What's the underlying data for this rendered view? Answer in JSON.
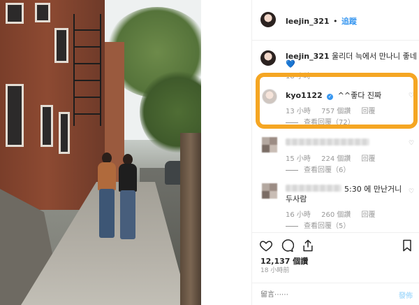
{
  "header": {
    "username": "leejin_321",
    "separator": "•",
    "follow_label": "追蹤"
  },
  "caption": {
    "username": "leejin_321",
    "text": "울리더 늑에서 만나니 좋네"
  },
  "comments": [
    {
      "username": "kyo1122",
      "text": "^^좋다 진짜",
      "time": "13 小時",
      "likes": "757 個讚",
      "reply": "回覆",
      "view_replies": "查看回覆（72）"
    },
    {
      "time": "15 小時",
      "likes": "224 個讚",
      "reply": "回覆",
      "view_replies": "查看回覆（6）"
    },
    {
      "text_line1": "5:30 에 만난거니",
      "text_line2": "두사람",
      "time": "16 小時",
      "likes": "260 個讚",
      "reply": "回覆",
      "view_replies": "查看回覆（5）"
    }
  ],
  "top_partial_time": "18 小時",
  "actions": {
    "like_count": "12,137 個讚",
    "posted_time": "18 小時前"
  },
  "comment_box": {
    "placeholder": "留言⋯⋯",
    "post_label": "發佈"
  },
  "colors": {
    "accent": "#3897f0",
    "highlight": "#f5a623",
    "heart_red": "#e0245e",
    "muted": "#999999"
  }
}
